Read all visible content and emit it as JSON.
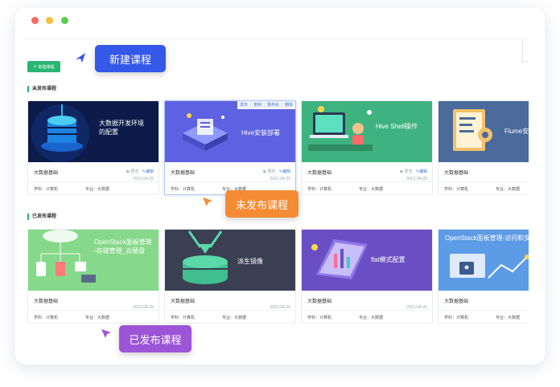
{
  "toolbar": {
    "new_course_label": "新建课程"
  },
  "sections": {
    "unpublished_title": "未发布课程",
    "published_title": "已发布课程"
  },
  "colors": {
    "accent_green": "#2ab573",
    "link_blue": "#3a7bd5",
    "callout_blue": "#3458e8",
    "callout_orange": "#f58b33",
    "callout_purple": "#9b55d6"
  },
  "unpublished_cards": [
    {
      "cover_title": "大数据开发环境\n的配置",
      "name": "大数据基础",
      "preview": "预览",
      "edit": "编辑",
      "date": "2021-04-25",
      "subject": "学科：计算机",
      "major": "专业：大数据"
    },
    {
      "cover_title": "Hive安装部署",
      "name": "大数据基础",
      "preview": "预览",
      "edit": "编辑",
      "date": "2021-04-25",
      "subject": "学科：计算机",
      "major": "专业：大数据",
      "actions": [
        "发布",
        "复制",
        "重命名",
        "删除"
      ]
    },
    {
      "cover_title": "Hive Shell操作",
      "name": "大数据基础",
      "preview": "预览",
      "edit": "编辑",
      "date": "2021-04-25",
      "subject": "学科：计算机",
      "major": "专业：大数据"
    },
    {
      "cover_title": "Flume安",
      "name": "大数据基础",
      "preview": "预",
      "edit": "",
      "date": "",
      "subject": "学科：计算机",
      "major": "专业：大数据"
    }
  ],
  "published_cards": [
    {
      "cover_title": "OpenStack面板管理\n-存储管理_云硬盘",
      "name": "大数据基础",
      "date": "2021-04-25",
      "subject": "学科：计算机",
      "major": "专业：大数据"
    },
    {
      "cover_title": "派生镜像",
      "name": "大数据基础",
      "date": "2021-04-25",
      "subject": "学科：计算机",
      "major": "专业：大数据"
    },
    {
      "cover_title": "flat模式配置",
      "name": "大数据基础",
      "date": "2021-04-25",
      "subject": "学科：计算机",
      "major": "专业：大数据"
    },
    {
      "cover_title": "OpenStack面板管理-访问和安全",
      "name": "大数据基础",
      "date": "2021-04-25",
      "subject": "学科：计算机",
      "major": "专业：大数据"
    }
  ],
  "callouts": {
    "new_course": "新建课程",
    "unpublished": "未发布课程",
    "published": "已发布课程"
  }
}
